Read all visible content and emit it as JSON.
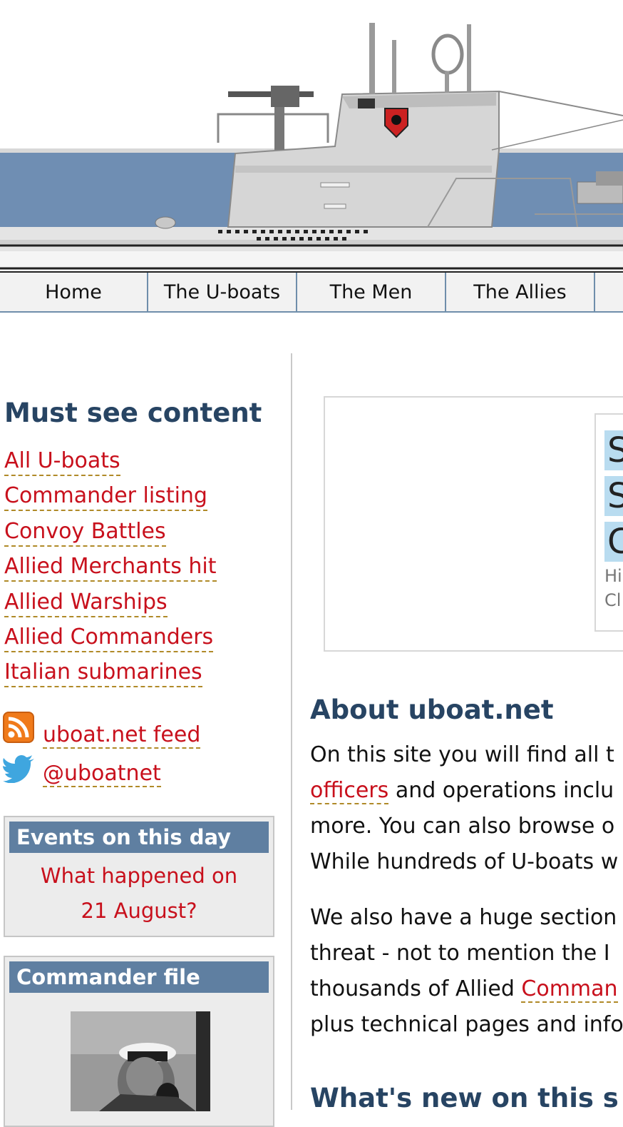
{
  "nav": {
    "items": [
      "Home",
      "The U-boats",
      "The Men",
      "The Allies"
    ]
  },
  "sidebar": {
    "must_see_title": "Must see content",
    "links": [
      "All U-boats",
      "Commander listing",
      "Convoy Battles",
      "Allied Merchants hit",
      "Allied Warships",
      "Allied Commanders",
      "Italian submarines"
    ],
    "feed_label": "uboat.net feed",
    "twitter_label": "@uboatnet",
    "feed_icon": "rss-icon",
    "twitter_icon": "twitter-bird-icon",
    "events_box": {
      "title": "Events on this day",
      "link_line1": "What happened on",
      "link_line2": "21 August?"
    },
    "commander_box": {
      "title": "Commander file"
    }
  },
  "main": {
    "featured": {
      "letters": [
        "S",
        "S",
        "C"
      ],
      "small_lines": [
        "Hi",
        "Cl"
      ]
    },
    "about_title": "About uboat.net",
    "about_p1": {
      "line1": "On this site you will find all t",
      "line2_link": "officers",
      "line2_rest": " and operations inclu",
      "line3": "more. You can also browse o",
      "line4": "While hundreds of U-boats w"
    },
    "about_p2": {
      "line1": "We also have a huge section",
      "line2": "threat - not to mention the I",
      "line3_pre": "thousands of Allied ",
      "line3_link": "Comman",
      "line4": "plus technical pages and info"
    },
    "whats_new_title": "What's new on this s"
  },
  "colors": {
    "heading": "#274463",
    "link": "#c8101c",
    "box_header": "#5f7fa1",
    "nav_border": "#6f8eab",
    "sea": "#6f8eb3"
  }
}
